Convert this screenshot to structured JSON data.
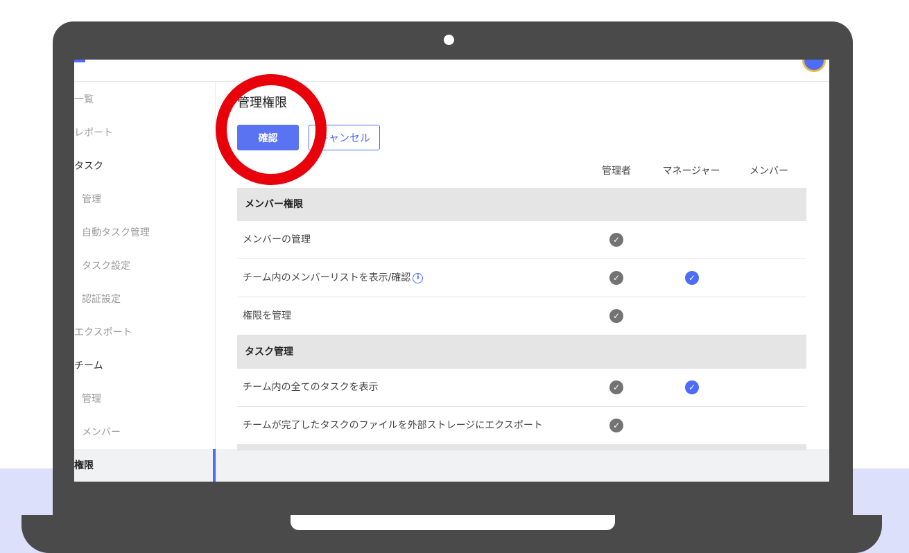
{
  "sidebar": {
    "items": [
      {
        "label": "一覧",
        "kind": "dim"
      },
      {
        "label": "レポート",
        "kind": "dim"
      },
      {
        "label": "タスク",
        "kind": "parent"
      },
      {
        "label": "管理",
        "kind": "sub"
      },
      {
        "label": "自動タスク管理",
        "kind": "sub"
      },
      {
        "label": "タスク設定",
        "kind": "sub"
      },
      {
        "label": "認証設定",
        "kind": "sub"
      },
      {
        "label": "エクスポート",
        "kind": "dim"
      },
      {
        "label": "チーム",
        "kind": "parent"
      },
      {
        "label": "管理",
        "kind": "sub"
      },
      {
        "label": "メンバー",
        "kind": "sub"
      },
      {
        "label": "権限",
        "kind": "active"
      }
    ]
  },
  "main": {
    "title": "管理権限",
    "confirm_label": "確認",
    "cancel_label": "キャンセル",
    "columns": [
      "管理者",
      "マネージャー",
      "メンバー"
    ]
  },
  "sections": [
    {
      "title": "メンバー権限",
      "rows": [
        {
          "label": "メンバーの管理",
          "info": false,
          "admin": true,
          "manager": false,
          "member": false
        },
        {
          "label": "チーム内のメンバーリストを表示/確認",
          "info": true,
          "admin": true,
          "manager": true,
          "member": false
        },
        {
          "label": "権限を管理",
          "info": false,
          "admin": true,
          "manager": false,
          "member": false
        }
      ]
    },
    {
      "title": "タスク管理",
      "rows": [
        {
          "label": "チーム内の全てのタスクを表示",
          "info": false,
          "admin": true,
          "manager": true,
          "member": false
        },
        {
          "label": "チームが完了したタスクのファイルを外部ストレージにエクスポート",
          "info": false,
          "admin": true,
          "manager": false,
          "member": false
        }
      ]
    }
  ],
  "icons": {
    "check": "checkmark-icon",
    "info": "info-icon"
  },
  "colors": {
    "accent": "#5a73f2",
    "check_gray": "#737373",
    "highlight_ring": "#e8000b"
  }
}
